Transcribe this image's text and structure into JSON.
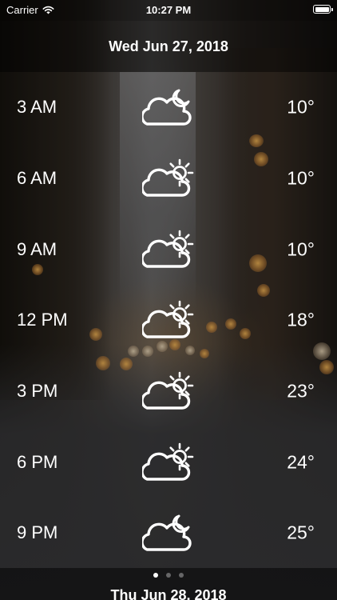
{
  "status_bar": {
    "carrier": "Carrier",
    "time": "10:27 PM",
    "wifi_icon": "wifi-icon",
    "battery_icon": "battery-icon",
    "battery_level": 1.0
  },
  "header": {
    "date": "Wed Jun 27, 2018"
  },
  "forecast": [
    {
      "time": "3 AM",
      "icon": "cloud-moon-icon",
      "temp": "10°"
    },
    {
      "time": "6 AM",
      "icon": "cloud-sun-icon",
      "temp": "10°"
    },
    {
      "time": "9 AM",
      "icon": "cloud-sun-icon",
      "temp": "10°"
    },
    {
      "time": "12 PM",
      "icon": "cloud-sun-icon",
      "temp": "18°"
    },
    {
      "time": "3 PM",
      "icon": "cloud-sun-icon",
      "temp": "23°"
    },
    {
      "time": "6 PM",
      "icon": "cloud-sun-icon",
      "temp": "24°"
    },
    {
      "time": "9 PM",
      "icon": "cloud-moon-icon",
      "temp": "25°"
    }
  ],
  "pager": {
    "page_count": 3,
    "current_page": 1
  },
  "next_day": {
    "date": "Thu Jun 28, 2018"
  }
}
